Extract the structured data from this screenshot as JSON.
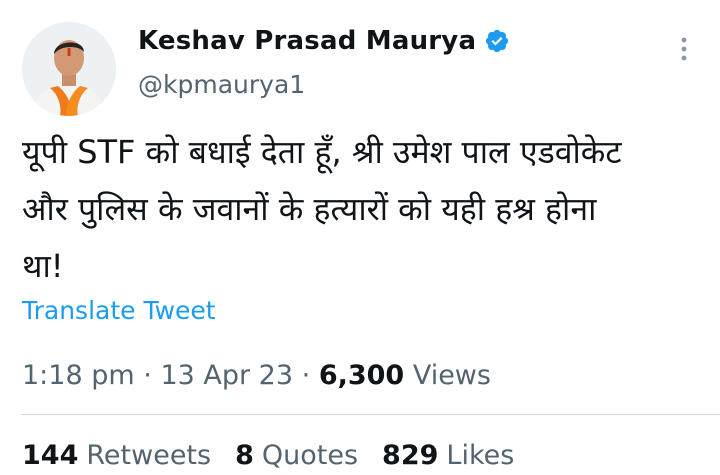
{
  "author": {
    "name": "Keshav Prasad Maurya",
    "handle": "@kpmaurya1",
    "verified": true,
    "verified_color": "#1d9bf0"
  },
  "tweet": {
    "lines": [
      "यूपी STF को बधाई देता हूँ, श्री उमेश पाल एडवोकेट",
      "और पुलिस के जवानों के हत्यारों को यही हश्र होना",
      "था!"
    ],
    "translate_label": "Translate Tweet"
  },
  "meta": {
    "time": "1:18 pm",
    "separator": "·",
    "date": "13 Apr 23",
    "views_count": "6,300",
    "views_label": "Views"
  },
  "stats": {
    "retweets_count": "144",
    "retweets_label": "Retweets",
    "quotes_count": "8",
    "quotes_label": "Quotes",
    "likes_count": "829",
    "likes_label": "Likes"
  },
  "icons": {
    "verified": "verified-badge-icon",
    "more": "more-options-icon"
  },
  "colors": {
    "link": "#1d9bf0",
    "secondary_text": "#536471",
    "primary_text": "#0f1419"
  }
}
